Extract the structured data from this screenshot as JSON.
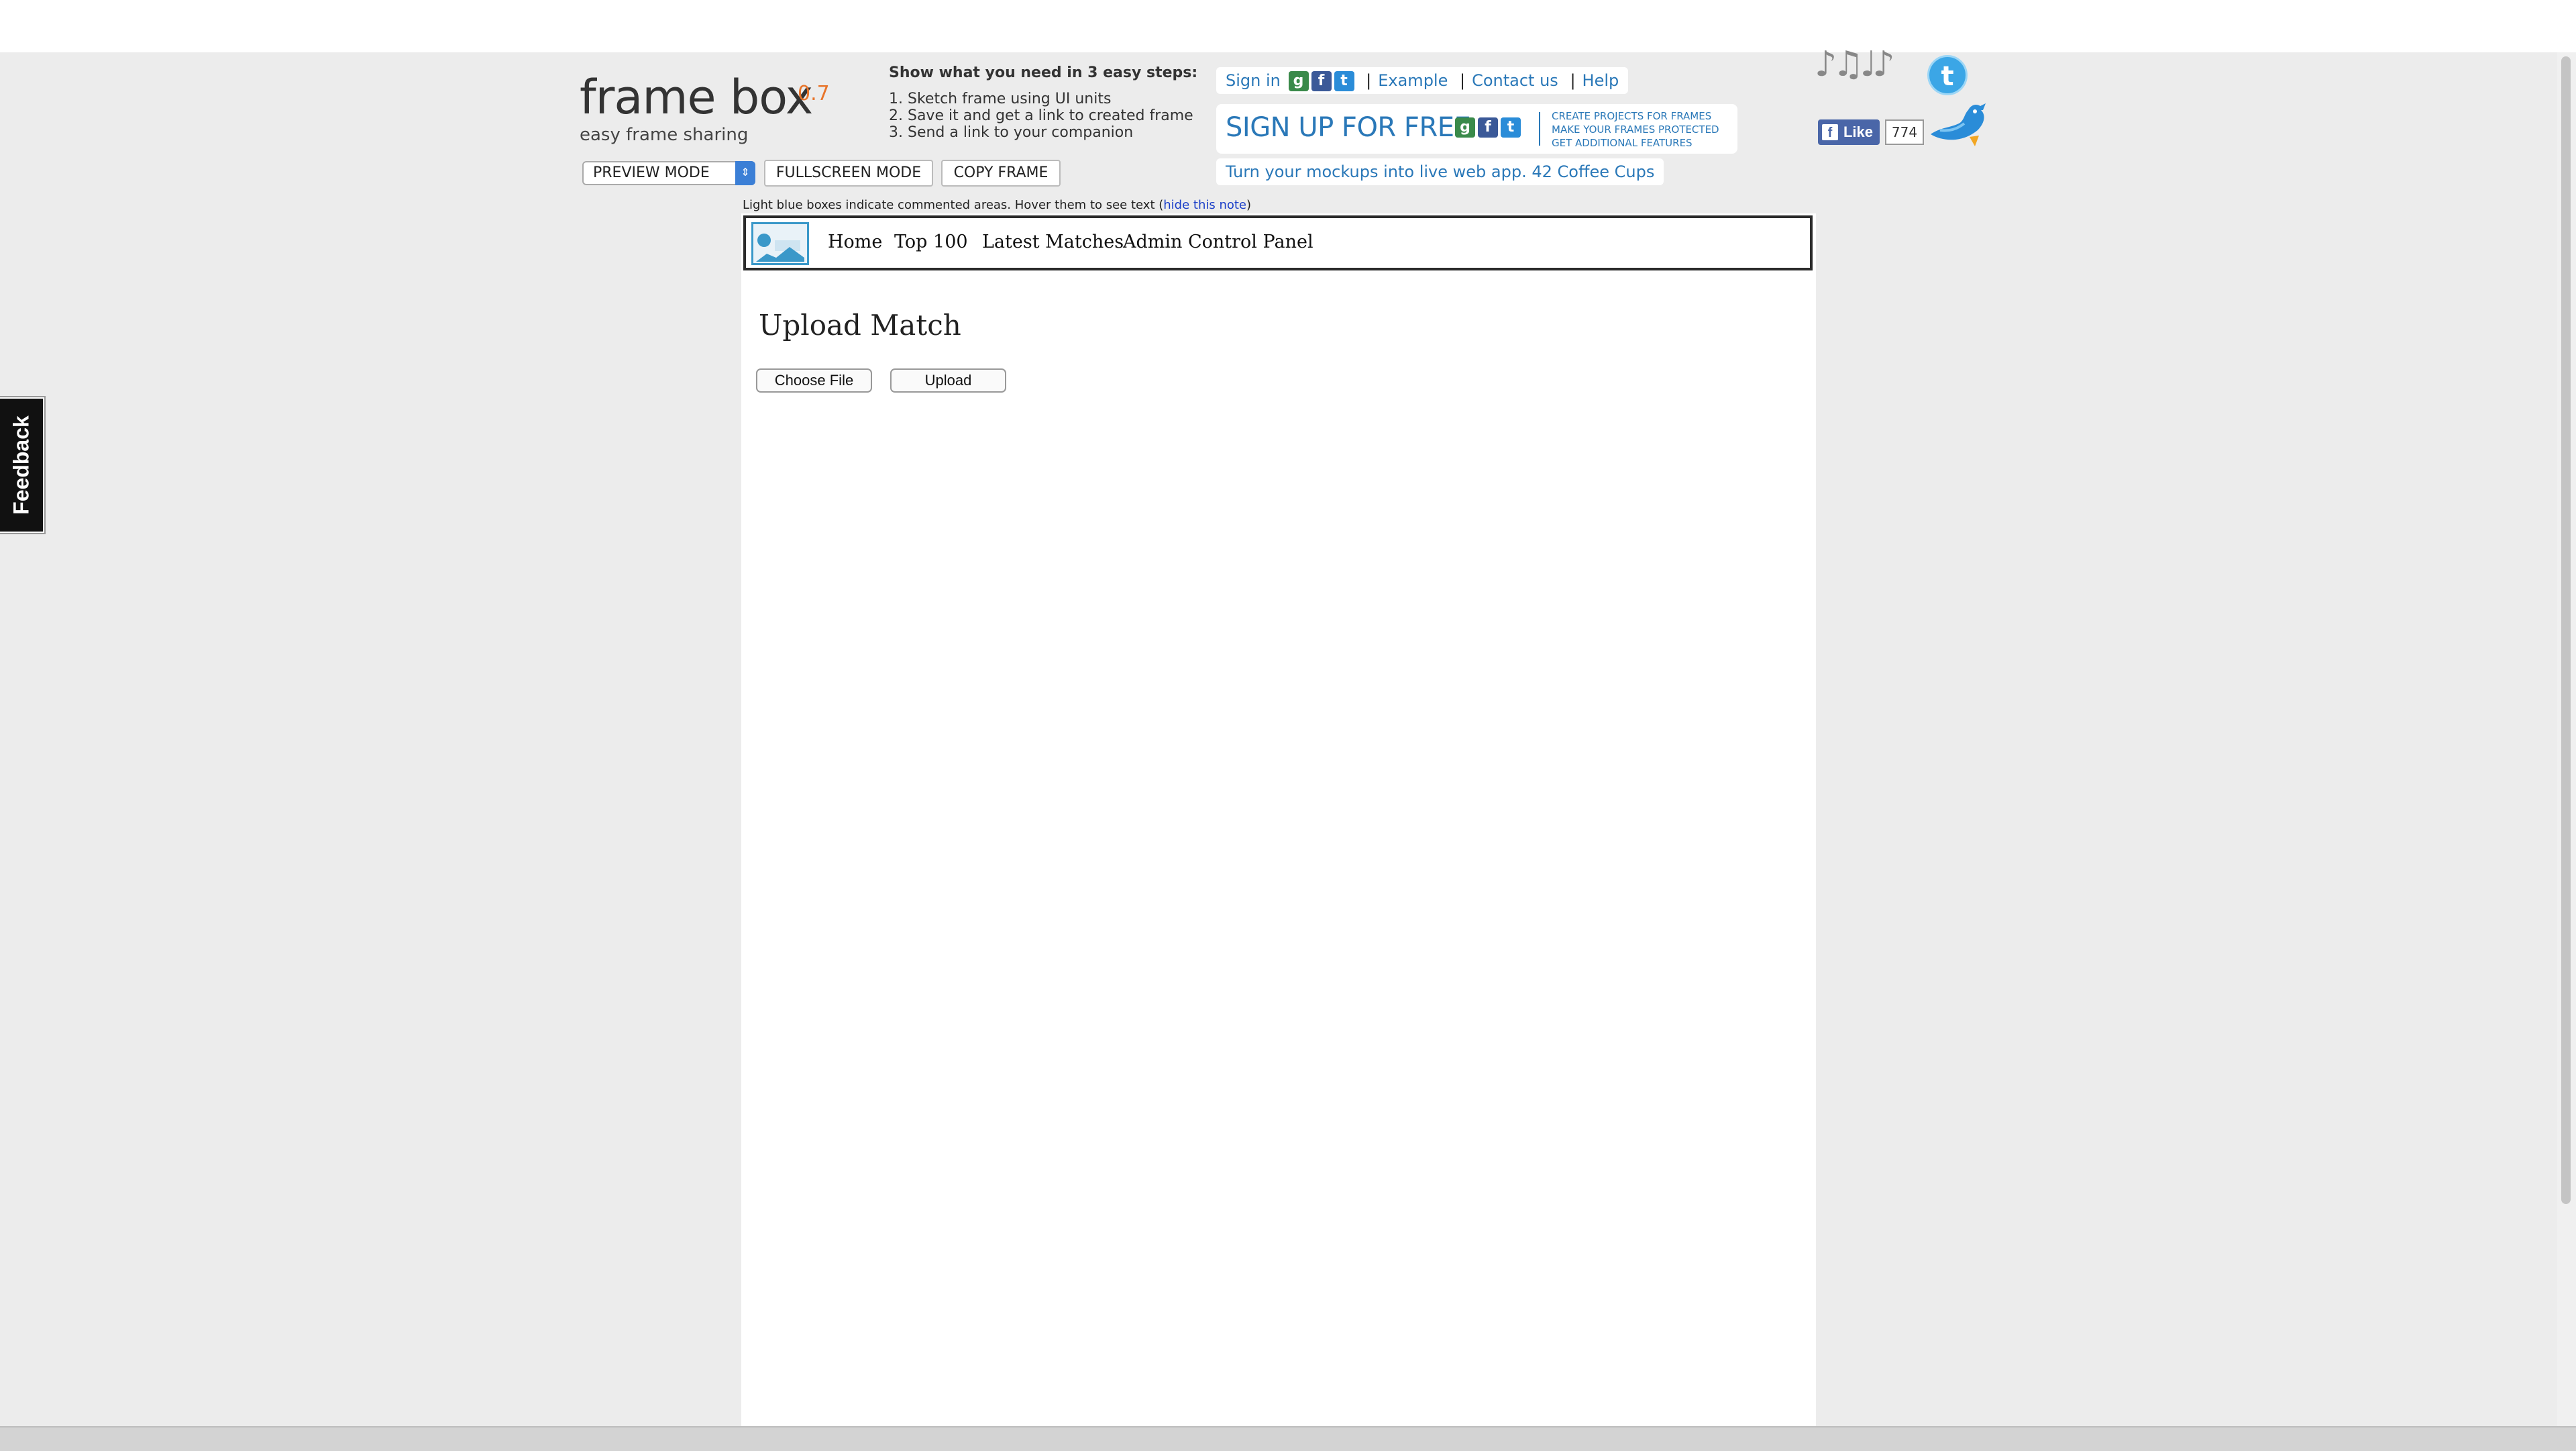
{
  "app": {
    "name": "frame box",
    "version": "0.7",
    "tagline": "easy frame sharing"
  },
  "toolbar": {
    "mode_select_value": "PREVIEW MODE",
    "fullscreen_label": "FULLSCREEN MODE",
    "copy_label": "COPY FRAME"
  },
  "steps": {
    "title": "Show what you need in 3 easy steps:",
    "items": [
      "1. Sketch frame using UI units",
      "2. Save it and get a link to created frame",
      "3. Send a link to your companion"
    ]
  },
  "links": {
    "sign_in": "Sign in",
    "separator": "|",
    "example": "Example",
    "contact": "Contact us",
    "help": "Help"
  },
  "signup": {
    "label": "SIGN UP FOR FREE",
    "benefits": [
      "CREATE PROJECTS FOR FRAMES",
      "MAKE YOUR FRAMES PROTECTED",
      "GET ADDITIONAL FEATURES"
    ]
  },
  "promo": {
    "text": "Turn your mockups into live web app. 42 Coffee Cups"
  },
  "social": {
    "like_label": "Like",
    "like_count": "774",
    "twitter_letter": "t",
    "music_notes": "♪♫♩♪"
  },
  "note": {
    "text": "Light blue boxes indicate commented areas. Hover them to see text (",
    "link": "hide this note",
    "close": ")"
  },
  "frame_nav": {
    "items": [
      "Home",
      "Top 100",
      "Latest Matches",
      "Admin Control Panel"
    ]
  },
  "content": {
    "heading": "Upload Match",
    "choose_file_label": "Choose File",
    "upload_label": "Upload"
  },
  "feedback": {
    "label": "Feedback"
  },
  "icons": {
    "google": "g",
    "facebook": "f",
    "twitter": "t"
  },
  "colors": {
    "background": "#ececec",
    "link_blue": "#2a78b8",
    "version_orange": "#e8742a",
    "frame_border": "#2b2b2b"
  }
}
